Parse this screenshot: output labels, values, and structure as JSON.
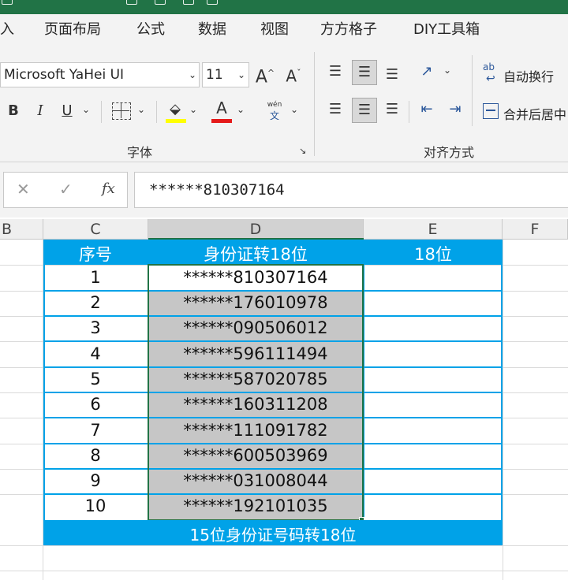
{
  "tabs": [
    "入",
    "页面布局",
    "公式",
    "数据",
    "视图",
    "方方格子",
    "DIY工具箱"
  ],
  "font": {
    "name": "Microsoft YaHei UI",
    "size": "11"
  },
  "ribbon": {
    "font_group_label": "字体",
    "align_group_label": "对齐方式",
    "grow_font_glyph": "A",
    "shrink_font_glyph": "A",
    "bold_glyph": "B",
    "italic_glyph": "I",
    "underline_glyph": "U",
    "font_color_glyph": "A",
    "phonetic_glyph": "wén",
    "phonetic_glyph2": "文",
    "wrap_text_icon_text": "ab",
    "wrap_text_label": "自动换行",
    "merge_center_label": "合并后居中"
  },
  "formula_bar": {
    "fx": "fx",
    "value": "******810307164"
  },
  "columns": [
    "B",
    "C",
    "D",
    "E",
    "F"
  ],
  "header_row": [
    "序号",
    "身份证转18位",
    "18位"
  ],
  "rows": [
    {
      "n": "1",
      "id": "******810307164"
    },
    {
      "n": "2",
      "id": "******176010978"
    },
    {
      "n": "3",
      "id": "******090506012"
    },
    {
      "n": "4",
      "id": "******596111494"
    },
    {
      "n": "5",
      "id": "******587020785"
    },
    {
      "n": "6",
      "id": "******160311208"
    },
    {
      "n": "7",
      "id": "******111091782"
    },
    {
      "n": "8",
      "id": "******600503969"
    },
    {
      "n": "9",
      "id": "******031008044"
    },
    {
      "n": "10",
      "id": "******192101035"
    }
  ],
  "footer": "15位身份证号码转18位",
  "colors": {
    "accent": "#00a2e8",
    "selection": "#c6c6c6",
    "selection_border": "#217346",
    "titlebar": "#217346"
  }
}
